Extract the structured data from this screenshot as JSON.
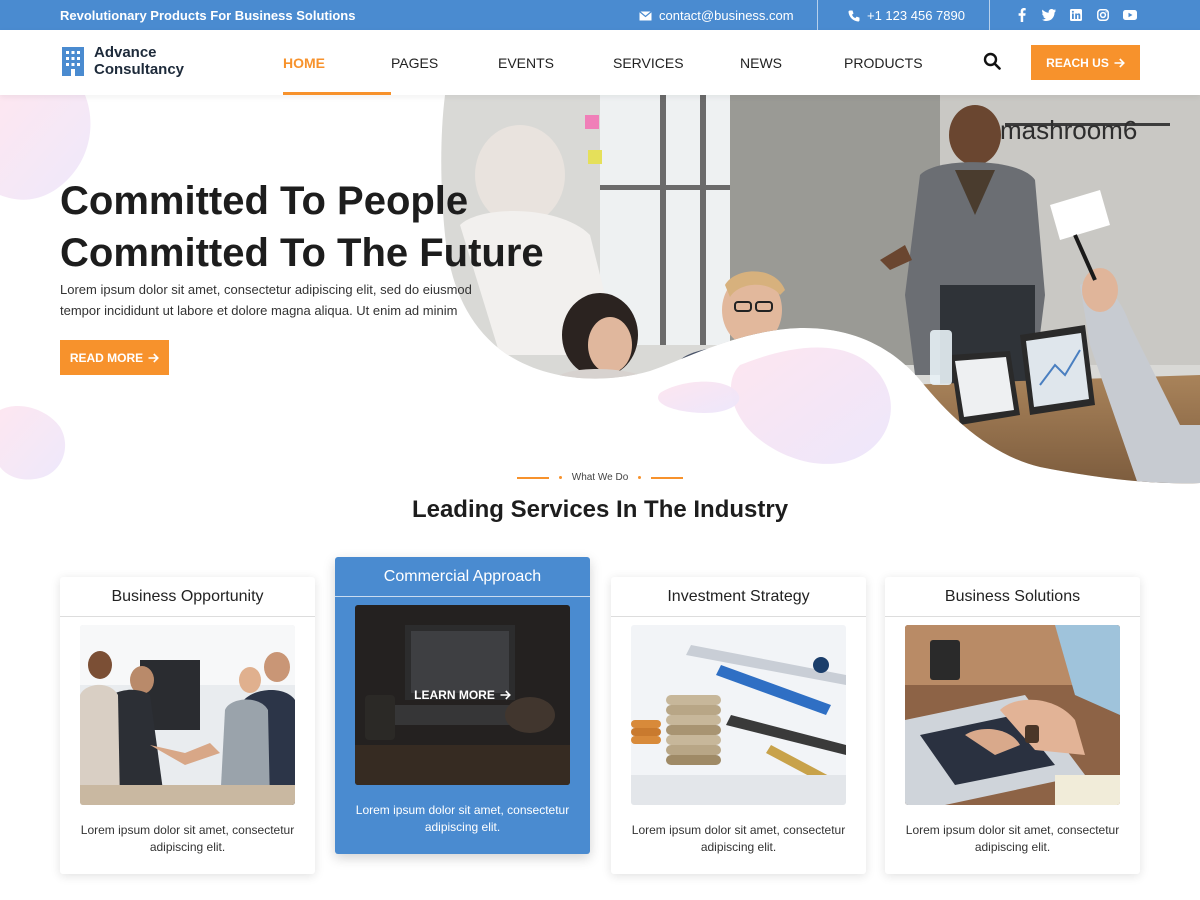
{
  "topbar": {
    "tagline": "Revolutionary Products For Business Solutions",
    "email": "contact@business.com",
    "phone": "+1 123 456 7890",
    "socials": [
      "facebook-icon",
      "twitter-icon",
      "linkedin-icon",
      "instagram-icon",
      "youtube-icon"
    ]
  },
  "header": {
    "logo_line1": "Advance",
    "logo_line2": "Consultancy",
    "nav": [
      "HOME",
      "PAGES",
      "EVENTS",
      "SERVICES",
      "NEWS",
      "PRODUCTS"
    ],
    "active_nav": "HOME",
    "cta_label": "REACH US"
  },
  "hero": {
    "title_line1": "Committed To People",
    "title_line2": "Committed To The Future",
    "text": "Lorem ipsum dolor sit amet, consectetur adipiscing elit, sed do eiusmod tempor incididunt ut labore et dolore magna aliqua. Ut enim ad minim",
    "button_label": "READ MORE",
    "wall_sign": "mashroom6"
  },
  "services": {
    "eyebrow": "What We Do",
    "title": "Leading Services In The Industry",
    "cards": [
      {
        "title": "Business Opportunity",
        "text": "Lorem ipsum dolor sit amet, consectetur adipiscing elit."
      },
      {
        "title": "Commercial Approach",
        "text": "Lorem ipsum dolor sit amet, consectetur adipiscing elit.",
        "button": "LEARN MORE"
      },
      {
        "title": "Investment Strategy",
        "text": "Lorem ipsum dolor sit amet, consectetur adipiscing elit."
      },
      {
        "title": "Business Solutions",
        "text": "Lorem ipsum dolor sit amet, consectetur adipiscing elit."
      }
    ]
  },
  "colors": {
    "primary_blue": "#4a8bd0",
    "accent_orange": "#f7922c"
  }
}
